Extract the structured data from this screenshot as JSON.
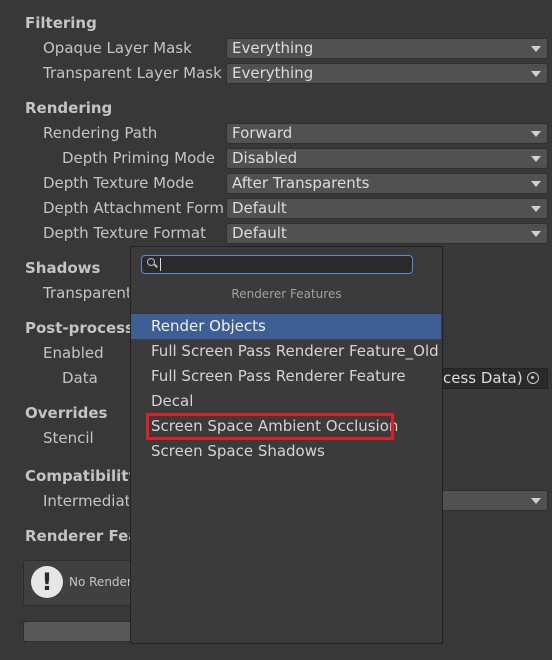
{
  "filtering": {
    "header": "Filtering",
    "opaque_label": "Opaque Layer Mask",
    "opaque_value": "Everything",
    "transparent_label": "Transparent Layer Mask",
    "transparent_value": "Everything"
  },
  "rendering": {
    "header": "Rendering",
    "path_label": "Rendering Path",
    "path_value": "Forward",
    "priming_label": "Depth Priming Mode",
    "priming_value": "Disabled",
    "depth_mode_label": "Depth Texture Mode",
    "depth_mode_value": "After Transparents",
    "attachment_label": "Depth Attachment Forma",
    "attachment_value": "Default",
    "depth_format_label": "Depth Texture Format",
    "depth_format_value": "Default"
  },
  "shadows": {
    "header": "Shadows",
    "transparent_label": "Transparent"
  },
  "postprocessing": {
    "header": "Post-processing",
    "enabled_label": "Enabled",
    "data_label": "Data",
    "data_value": "cess Data)"
  },
  "overrides": {
    "header": "Overrides",
    "stencil_label": "Stencil"
  },
  "compatibility": {
    "header": "Compatibility",
    "intermediate_label": "Intermediate"
  },
  "renderer_features": {
    "header": "Renderer Featu",
    "empty_text": "No Rendere"
  },
  "popup": {
    "title": "Renderer Features",
    "search_value": "",
    "items": [
      "Render Objects",
      "Full Screen Pass Renderer Feature_Old GU",
      "Full Screen Pass Renderer Feature",
      "Decal",
      "Screen Space Ambient Occlusion",
      "Screen Space Shadows"
    ]
  },
  "colors": {
    "background": "#383838",
    "selected": "#3e5f96",
    "highlight": "#e01e24"
  }
}
